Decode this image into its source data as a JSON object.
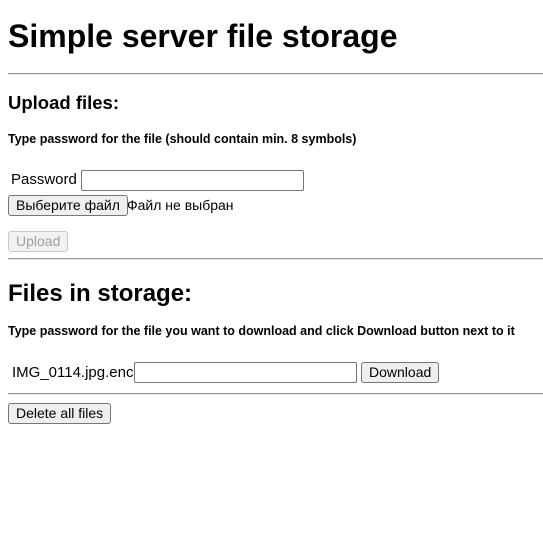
{
  "page": {
    "title": "Simple server file storage"
  },
  "upload": {
    "heading": "Upload files:",
    "hint": "Type password for the file (should contain min. 8 symbols)",
    "password_label": "Password",
    "password_value": "",
    "choose_file_label": "Выберите файл",
    "file_status": "Файл не выбран",
    "upload_label": "Upload",
    "upload_disabled": true
  },
  "storage": {
    "heading": "Files in storage:",
    "hint": "Type password for the file you want to download and click Download button next to it",
    "files": [
      {
        "name": "IMG_0114.jpg.enc",
        "password_value": "",
        "download_label": "Download"
      }
    ],
    "delete_all_label": "Delete all files"
  }
}
